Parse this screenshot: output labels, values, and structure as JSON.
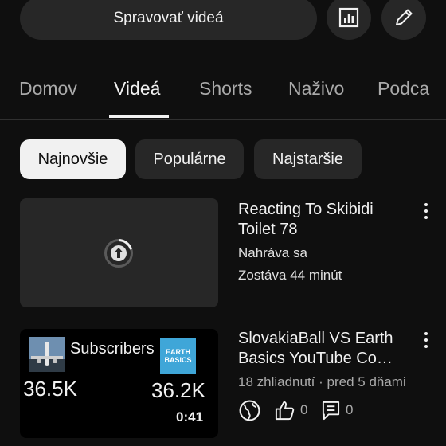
{
  "header": {
    "manage_videos_label": "Spravovať videá",
    "analytics_icon": "bar-chart-icon",
    "edit_icon": "pencil-icon"
  },
  "tabs": [
    {
      "label": "Domov"
    },
    {
      "label": "Videá",
      "active": true
    },
    {
      "label": "Shorts"
    },
    {
      "label": "Naživo"
    },
    {
      "label": "Podca"
    }
  ],
  "chips": [
    {
      "label": "Najnovšie",
      "selected": true
    },
    {
      "label": "Populárne"
    },
    {
      "label": "Najstaršie"
    }
  ],
  "videos": [
    {
      "title": "Reacting To Skibidi Toilet 78",
      "status": "Nahráva sa",
      "remaining": "Zostáva 44 minút",
      "thumb_icon": "upload-progress-icon"
    },
    {
      "title": "SlovakiaBall VS Earth Basics YouTube Co…",
      "meta": "18 zhliadnutí · pred 5 dňami",
      "duration": "0:41",
      "visibility_icon": "globe-icon",
      "likes": "0",
      "comments": "0",
      "thumbnail": {
        "subscribers_label": "Subscribers",
        "left_count": "36.5K",
        "right_count": "36.2K",
        "right_logo_text": "EARTH BASICS"
      }
    }
  ],
  "colors": {
    "background": "#0f0f0f",
    "surface": "#272727",
    "text": "#f1f1f1",
    "secondary_text": "#aaaaaa"
  }
}
